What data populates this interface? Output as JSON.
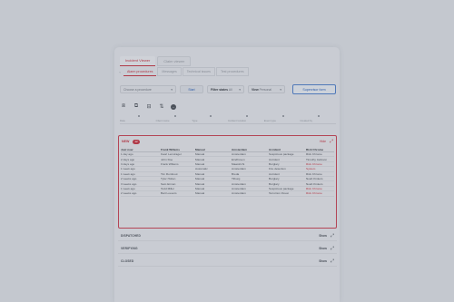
{
  "tabs_top": [
    "Incident Viewer",
    "Claim viewer"
  ],
  "tabs_sub": [
    "Alarm procedures",
    "Messages",
    "Technical issues",
    "Test procedures"
  ],
  "toolbar": {
    "procedure_select": "Choose a procedure",
    "start_label": "Start",
    "filter_label": "Filter states",
    "filter_value": "All",
    "view_label": "View",
    "view_value": "Personal",
    "form_label": "Supervisor form"
  },
  "icons": [
    "filter-a-icon",
    "filter-b-icon",
    "filter-c-icon",
    "sort-icon",
    "block-icon"
  ],
  "column_headers": [
    "Date",
    "Client name",
    "Type",
    "Incident location",
    "Event type",
    "Created by"
  ],
  "new_section": {
    "label": "NEW",
    "count": "12",
    "hide_label": "Hide",
    "headers": [
      "Just now",
      "Frank Willems",
      "Manual",
      "Amsterdam",
      "Accident",
      "Rick Chrome"
    ],
    "rows": [
      [
        "1 day ago",
        "Kaori Lenstrager",
        "Manual",
        "Amsterdam",
        "Suspicious package",
        "Rick Chrome"
      ],
      [
        "2 days ago",
        "John Doe",
        "Manual",
        "Eindhoven",
        "Accident",
        "Timothy Jackson"
      ],
      [
        "3 days ago",
        "Frank Willems",
        "Manual",
        "Maastricht",
        "Burglary",
        "Rick Chrome"
      ],
      [
        "1 week ago",
        "",
        "Automatic",
        "Amsterdam",
        "Fire detection",
        "System"
      ],
      [
        "1 week ago",
        "Tim Rombout",
        "Manual",
        "Breda",
        "Accident",
        "Rick Chrome"
      ],
      [
        "2 weeks ago",
        "Tyler Hollen",
        "Manual",
        "Tilburg",
        "Burglary",
        "Noah Kinkers"
      ],
      [
        "3 weeks ago",
        "Sam Erman",
        "Manual",
        "Amsterdam",
        "Burglary",
        "Noah Kinkers"
      ],
      [
        "1 week ago",
        "Todd Miller",
        "Manual",
        "Amsterdam",
        "Suspicious package",
        "Rick Chrome"
      ],
      [
        "2 weeks ago",
        "Bart Loevers",
        "Manual",
        "Amsterdam",
        "Terrorism threat",
        "Rick Chrome"
      ]
    ],
    "red_rows": [
      2,
      3,
      7,
      8
    ]
  },
  "collapsed_sections": [
    {
      "label": "DISPATCHED",
      "show_label": "Show"
    },
    {
      "label": "VERIFYING",
      "show_label": "Show"
    },
    {
      "label": "CLOSED",
      "show_label": "Show"
    }
  ]
}
